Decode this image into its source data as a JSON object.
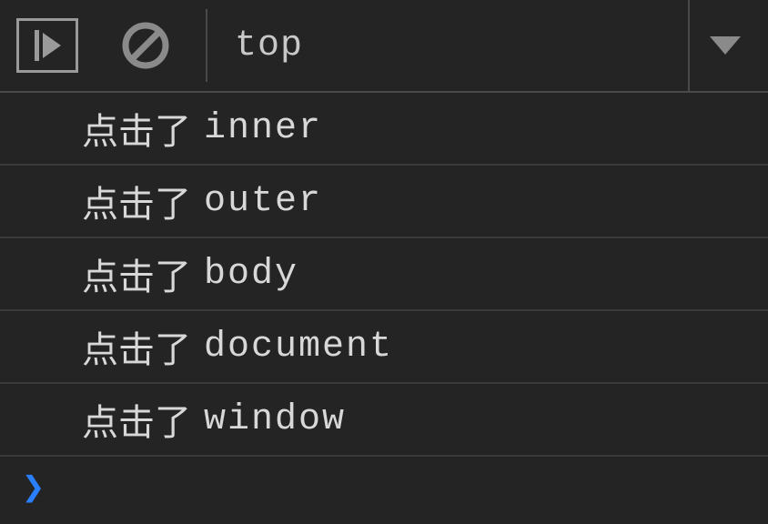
{
  "toolbar": {
    "context_label": "top"
  },
  "logs": [
    {
      "prefix": "点击了",
      "target": "inner"
    },
    {
      "prefix": "点击了",
      "target": "outer"
    },
    {
      "prefix": "点击了",
      "target": "body"
    },
    {
      "prefix": "点击了",
      "target": "document"
    },
    {
      "prefix": "点击了",
      "target": "window"
    }
  ],
  "prompt": {
    "chevron": "❯"
  }
}
